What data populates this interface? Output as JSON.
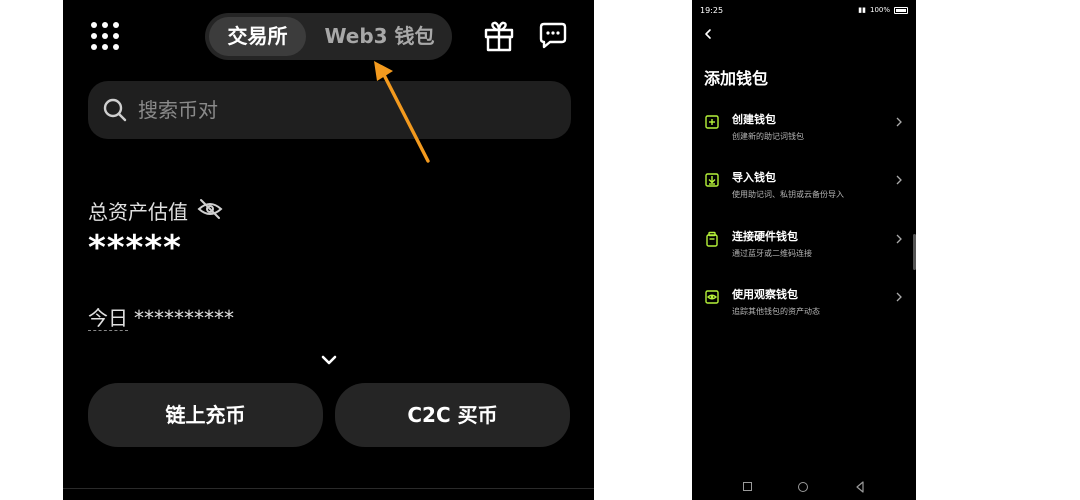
{
  "left_app": {
    "tabs": {
      "active": "交易所",
      "inactive": "Web3 钱包"
    },
    "search": {
      "placeholder": "搜索币对"
    },
    "assets": {
      "label": "总资产估值",
      "value": "*****"
    },
    "today": {
      "label": "今日",
      "value": "**********"
    },
    "buttons": {
      "deposit": "链上充币",
      "c2c": "C2C 买币"
    },
    "icons": {
      "menu": "grid-menu-icon",
      "gift": "gift-icon",
      "chat": "chat-icon",
      "search": "search-icon",
      "hide": "eye-off-icon",
      "expand": "chevron-down-icon",
      "pointer": "arrow-annotation-icon"
    },
    "accent": "#f39a1e"
  },
  "phone": {
    "status": {
      "time": "19:25",
      "battery": "100%"
    },
    "title": "添加钱包",
    "items": [
      {
        "title": "创建钱包",
        "subtitle": "创建新的助记词钱包",
        "icon": "plus-square-icon"
      },
      {
        "title": "导入钱包",
        "subtitle": "使用助记词、私钥或云备份导入",
        "icon": "import-icon"
      },
      {
        "title": "连接硬件钱包",
        "subtitle": "通过蓝牙或二维码连接",
        "icon": "hardware-wallet-icon"
      },
      {
        "title": "使用观察钱包",
        "subtitle": "追踪其他钱包的资产动态",
        "icon": "eye-icon"
      }
    ],
    "accent": "#b6f33a"
  }
}
